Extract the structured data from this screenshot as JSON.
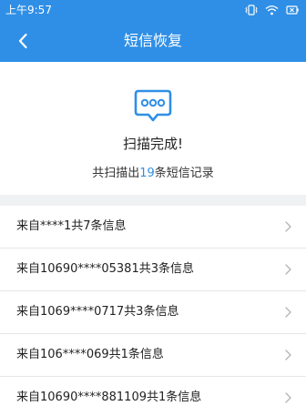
{
  "status_bar": {
    "time": "上午9:57",
    "icons": [
      "vibrate-icon",
      "wifi-icon",
      "battery-icon"
    ]
  },
  "nav": {
    "back_icon": "chevron-left-icon",
    "title": "短信恢复"
  },
  "summary": {
    "icon": "sms-chat-bubble-icon",
    "title": "扫描完成!",
    "count_prefix": "共扫描出",
    "count_value": "19",
    "count_suffix": "条短信记录"
  },
  "messages": [
    {
      "label": "来自****1共7条信息"
    },
    {
      "label": "来自10690****05381共3条信息"
    },
    {
      "label": "来自1069****0717共3条信息"
    },
    {
      "label": "来自106****069共1条信息"
    },
    {
      "label": "来自10690****881109共1条信息"
    }
  ],
  "colors": {
    "accent": "#2f8fe6",
    "separator": "#f0f1f3",
    "text": "#222222"
  }
}
